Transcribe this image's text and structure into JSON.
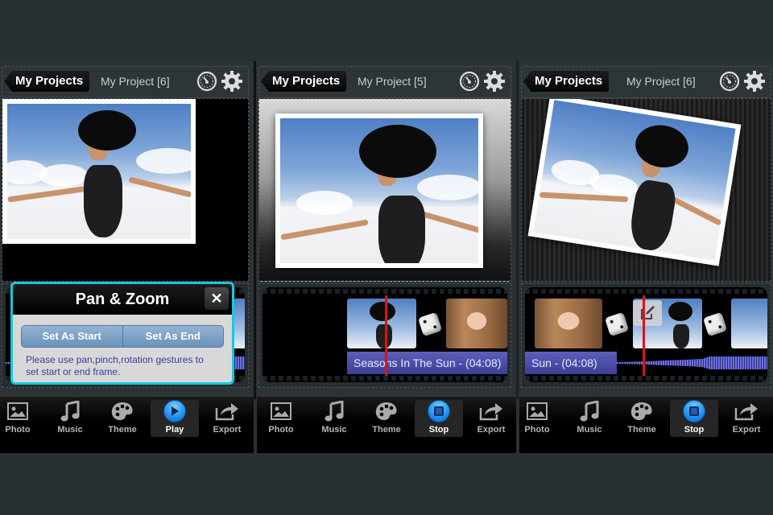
{
  "panels": [
    {
      "back_label": "My Projects",
      "project_title": "My Project [6]",
      "active_tab": 3,
      "tabs": [
        {
          "label": "Photo",
          "icon": "photo-icon"
        },
        {
          "label": "Music",
          "icon": "music-icon"
        },
        {
          "label": "Theme",
          "icon": "theme-icon"
        },
        {
          "label": "Play",
          "icon": "play-icon"
        },
        {
          "label": "Export",
          "icon": "export-icon"
        }
      ],
      "dialog": {
        "title": "Pan & Zoom",
        "close_label": "✕",
        "set_start_label": "Set As Start",
        "set_end_label": "Set As End",
        "message": "Please use pan,pinch,rotation gestures to set start or end frame."
      }
    },
    {
      "back_label": "My Projects",
      "project_title": "My Project [5]",
      "active_tab": 3,
      "tabs": [
        {
          "label": "Photo",
          "icon": "photo-icon"
        },
        {
          "label": "Music",
          "icon": "music-icon"
        },
        {
          "label": "Theme",
          "icon": "theme-icon"
        },
        {
          "label": "Stop",
          "icon": "stop-icon"
        },
        {
          "label": "Export",
          "icon": "export-icon"
        }
      ],
      "music_track": "Seasons In The Sun - (04:08)"
    },
    {
      "back_label": "My Projects",
      "project_title": "My Project [6]",
      "active_tab": 3,
      "tabs": [
        {
          "label": "Photo",
          "icon": "photo-icon"
        },
        {
          "label": "Music",
          "icon": "music-icon"
        },
        {
          "label": "Theme",
          "icon": "theme-icon"
        },
        {
          "label": "Stop",
          "icon": "stop-icon"
        },
        {
          "label": "Export",
          "icon": "export-icon"
        }
      ],
      "music_track": "Sun - (04:08)"
    }
  ],
  "colors": {
    "accent_cyan": "#14c9dc",
    "play_blue": "#1b8ff0",
    "music_bar": "#4a4ea8",
    "playhead_red": "#e21010"
  }
}
